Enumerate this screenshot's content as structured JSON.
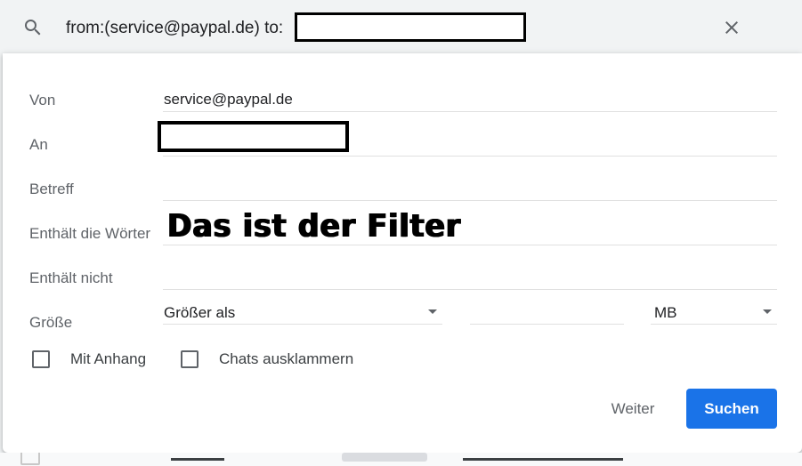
{
  "search": {
    "query": "from:(service@paypal.de) to:"
  },
  "fields": {
    "from_label": "Von",
    "from_value": "service@paypal.de",
    "to_label": "An",
    "subject_label": "Betreff",
    "has_words_label": "Enthält die Wörter",
    "has_words_annotation": "Das ist der Filter",
    "doesnt_have_label": "Enthält nicht",
    "size_label": "Größe",
    "size_operator": "Größer als",
    "size_unit": "MB"
  },
  "checkboxes": {
    "has_attachment": "Mit Anhang",
    "exclude_chats": "Chats ausklammern"
  },
  "buttons": {
    "more": "Weiter",
    "search": "Suchen"
  },
  "colors": {
    "primary": "#1a73e8",
    "label": "#5f6368",
    "background": "#f1f3f4"
  }
}
